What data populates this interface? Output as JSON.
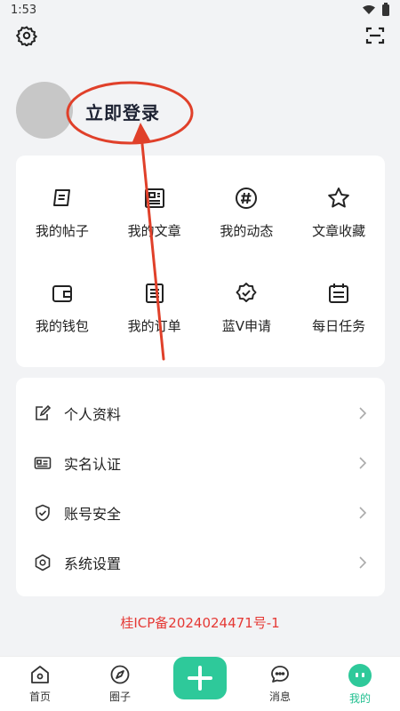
{
  "status_bar": {
    "time": "1:53"
  },
  "profile": {
    "login_label": "立即登录"
  },
  "grid": {
    "items": [
      {
        "label": "我的帖子",
        "icon": "post-icon"
      },
      {
        "label": "我的文章",
        "icon": "article-icon"
      },
      {
        "label": "我的动态",
        "icon": "hashtag-icon"
      },
      {
        "label": "文章收藏",
        "icon": "star-icon"
      },
      {
        "label": "我的钱包",
        "icon": "wallet-icon"
      },
      {
        "label": "我的订单",
        "icon": "order-icon"
      },
      {
        "label": "蓝V申请",
        "icon": "verified-badge-icon"
      },
      {
        "label": "每日任务",
        "icon": "calendar-icon"
      }
    ]
  },
  "menu": {
    "items": [
      {
        "label": "个人资料",
        "icon": "edit-icon"
      },
      {
        "label": "实名认证",
        "icon": "id-card-icon"
      },
      {
        "label": "账号安全",
        "icon": "shield-icon"
      },
      {
        "label": "系统设置",
        "icon": "settings-hex-icon"
      }
    ]
  },
  "icp": "桂ICP备2024024471号-1",
  "bottom_nav": {
    "items": [
      {
        "label": "首页",
        "icon": "home-icon"
      },
      {
        "label": "圈子",
        "icon": "compass-icon"
      },
      {
        "label": "",
        "icon": "plus-icon"
      },
      {
        "label": "消息",
        "icon": "chat-icon"
      },
      {
        "label": "我的",
        "icon": "me-icon"
      }
    ]
  },
  "colors": {
    "accent": "#2ec99a",
    "annotation": "#e0402a",
    "icp": "#e53935"
  }
}
